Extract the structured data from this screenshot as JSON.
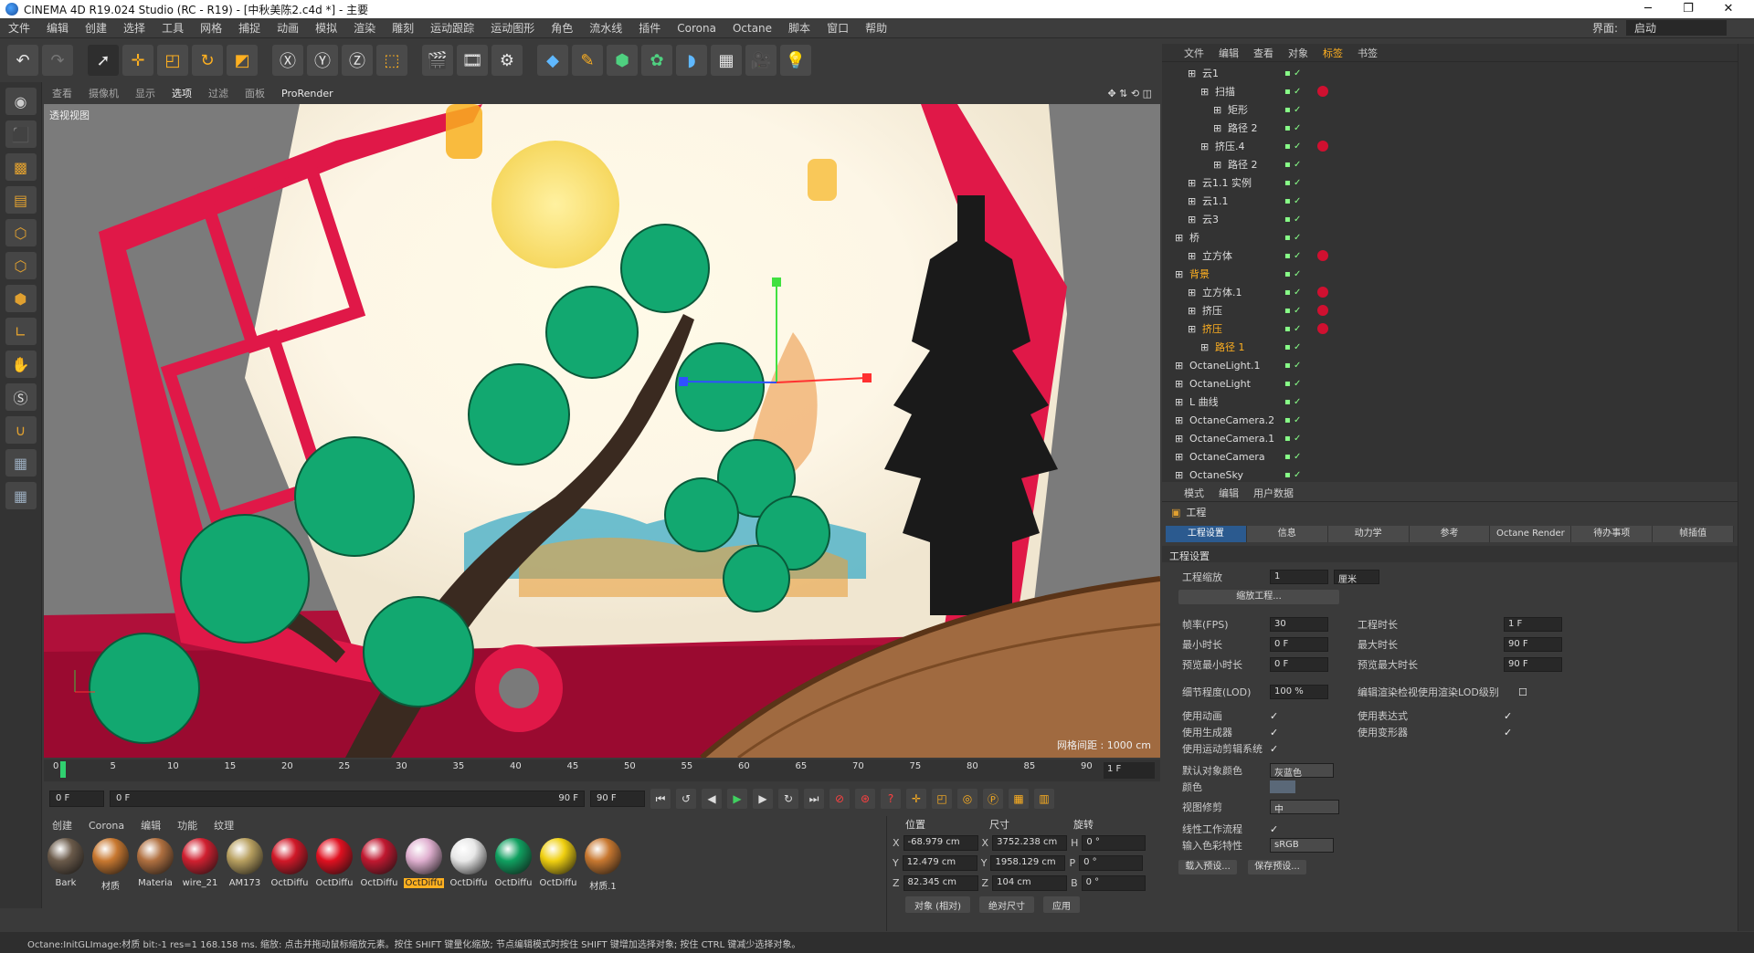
{
  "window": {
    "title": "CINEMA 4D R19.024 Studio (RC - R19) - [中秋美陈2.c4d *] - 主要",
    "minimize": "─",
    "maximize": "❐",
    "close": "✕"
  },
  "menu": {
    "items": [
      "文件",
      "编辑",
      "创建",
      "选择",
      "工具",
      "网格",
      "捕捉",
      "动画",
      "模拟",
      "渲染",
      "雕刻",
      "运动跟踪",
      "运动图形",
      "角色",
      "流水线",
      "插件",
      "Corona",
      "Octane",
      "脚本",
      "窗口",
      "帮助"
    ],
    "layout_label": "界面:",
    "layout_value": "启动"
  },
  "viewport": {
    "menu": [
      "查看",
      "摄像机",
      "显示",
      "选项",
      "过滤",
      "面板",
      "ProRender"
    ],
    "label": "透视视图",
    "grid": "网格间距 : 1000 cm"
  },
  "timeline": {
    "ticks": [
      "0",
      "5",
      "10",
      "15",
      "20",
      "25",
      "30",
      "35",
      "40",
      "45",
      "50",
      "55",
      "60",
      "65",
      "70",
      "75",
      "80",
      "85",
      "90"
    ],
    "current_frame": "1 F",
    "start": "0 F",
    "range_start": "0 F",
    "range_end": "90 F",
    "end": "90 F"
  },
  "materials": {
    "menu": [
      "创建",
      "Corona",
      "编辑",
      "功能",
      "纹理"
    ],
    "items": [
      {
        "name": "Bark",
        "color": "#6a5a4a"
      },
      {
        "name": "材质",
        "color": "#c87830"
      },
      {
        "name": "Materia",
        "color": "#b07040"
      },
      {
        "name": "wire_21",
        "color": "#d02030"
      },
      {
        "name": "AM173",
        "color": "#b8a060"
      },
      {
        "name": "OctDiffu",
        "color": "#d01828"
      },
      {
        "name": "OctDiffu",
        "color": "#e01020"
      },
      {
        "name": "OctDiffu",
        "color": "#c01830"
      },
      {
        "name": "OctDiffu",
        "color": "#e0b0d0"
      },
      {
        "name": "OctDiffu",
        "color": "#e8e8e8"
      },
      {
        "name": "OctDiffu",
        "color": "#10a060"
      },
      {
        "name": "OctDiffu",
        "color": "#f0d010"
      },
      {
        "name": "材质.1",
        "color": "#c87830"
      }
    ]
  },
  "coords": {
    "headers": [
      "位置",
      "尺寸",
      "旋转"
    ],
    "rows": [
      {
        "axis": "X",
        "pos": "-68.979 cm",
        "saxis": "X",
        "size": "3752.238 cm",
        "raxis": "H",
        "rot": "0 °"
      },
      {
        "axis": "Y",
        "pos": "12.479 cm",
        "saxis": "Y",
        "size": "1958.129 cm",
        "raxis": "P",
        "rot": "0 °"
      },
      {
        "axis": "Z",
        "pos": "82.345 cm",
        "saxis": "Z",
        "size": "104 cm",
        "raxis": "B",
        "rot": "0 °"
      }
    ],
    "mode": "对象 (相对)",
    "size_mode": "绝对尺寸",
    "apply": "应用"
  },
  "objects": {
    "menu": [
      "文件",
      "编辑",
      "查看",
      "对象",
      "标签",
      "书签"
    ],
    "items": [
      {
        "name": "云1",
        "indent": 28,
        "hl": false,
        "tag": false
      },
      {
        "name": "扫描",
        "indent": 42,
        "hl": false,
        "tag": true
      },
      {
        "name": "矩形",
        "indent": 56,
        "hl": false,
        "tag": false
      },
      {
        "name": "路径 2",
        "indent": 56,
        "hl": false,
        "tag": false
      },
      {
        "name": "挤压.4",
        "indent": 42,
        "hl": false,
        "tag": true
      },
      {
        "name": "路径 2",
        "indent": 56,
        "hl": false,
        "tag": false
      },
      {
        "name": "云1.1 实例",
        "indent": 28,
        "hl": false,
        "tag": false
      },
      {
        "name": "云1.1",
        "indent": 28,
        "hl": false,
        "tag": false
      },
      {
        "name": "云3",
        "indent": 28,
        "hl": false,
        "tag": false
      },
      {
        "name": "桥",
        "indent": 14,
        "hl": false,
        "tag": false
      },
      {
        "name": "立方体",
        "indent": 28,
        "hl": false,
        "tag": true
      },
      {
        "name": "背景",
        "indent": 14,
        "hl": true,
        "tag": false
      },
      {
        "name": "立方体.1",
        "indent": 28,
        "hl": false,
        "tag": true
      },
      {
        "name": "挤压",
        "indent": 28,
        "hl": false,
        "tag": true
      },
      {
        "name": "挤压",
        "indent": 28,
        "hl": true,
        "tag": true
      },
      {
        "name": "路径 1",
        "indent": 42,
        "hl": true,
        "tag": false
      },
      {
        "name": "OctaneLight.1",
        "indent": 14,
        "hl": false,
        "tag": false
      },
      {
        "name": "OctaneLight",
        "indent": 14,
        "hl": false,
        "tag": false
      },
      {
        "name": "L 曲线",
        "indent": 14,
        "hl": false,
        "tag": false
      },
      {
        "name": "OctaneCamera.2",
        "indent": 14,
        "hl": false,
        "tag": false
      },
      {
        "name": "OctaneCamera.1",
        "indent": 14,
        "hl": false,
        "tag": false
      },
      {
        "name": "OctaneCamera",
        "indent": 14,
        "hl": false,
        "tag": false
      },
      {
        "name": "OctaneSky",
        "indent": 14,
        "hl": false,
        "tag": false
      }
    ]
  },
  "attributes": {
    "menu": [
      "模式",
      "编辑",
      "用户数据"
    ],
    "title": "工程",
    "tabs": [
      "工程设置",
      "信息",
      "动力学",
      "参考",
      "Octane Render",
      "待办事项",
      "帧插值"
    ],
    "section": "工程设置",
    "scale_label": "工程缩放",
    "scale_value": "1",
    "scale_unit": "厘米",
    "scale_btn": "缩放工程...",
    "fps_label": "帧率(FPS)",
    "fps": "30",
    "duration_label": "工程时长",
    "duration": "1 F",
    "min_label": "最小时长",
    "min": "0 F",
    "max_label": "最大时长",
    "max": "90 F",
    "pmin_label": "预览最小时长",
    "pmin": "0 F",
    "pmax_label": "预览最大时长",
    "pmax": "90 F",
    "lod_label": "细节程度(LOD)",
    "lod": "100 %",
    "lod_check": "编辑渲染检视使用渲染LOD级别",
    "anim_label": "使用动画",
    "expr_label": "使用表达式",
    "gen_label": "使用生成器",
    "deform_label": "使用变形器",
    "motion_label": "使用运动剪辑系统",
    "objcolor_label": "默认对象颜色",
    "objcolor": "灰蓝色",
    "color_label": "颜色",
    "clip_label": "视图修剪",
    "clip": "中",
    "linear_label": "线性工作流程",
    "cprofile_label": "输入色彩特性",
    "cprofile": "sRGB",
    "load_btn": "载入预设...",
    "save_btn": "保存预设..."
  },
  "status": "Octane:InitGLImage:材质 bit:-1 res=1 168.158 ms.   缩放: 点击并拖动鼠标缩放元素。按住 SHIFT 键量化缩放; 节点编辑模式时按住 SHIFT 键增加选择对象; 按住 CTRL 键减少选择对象。"
}
